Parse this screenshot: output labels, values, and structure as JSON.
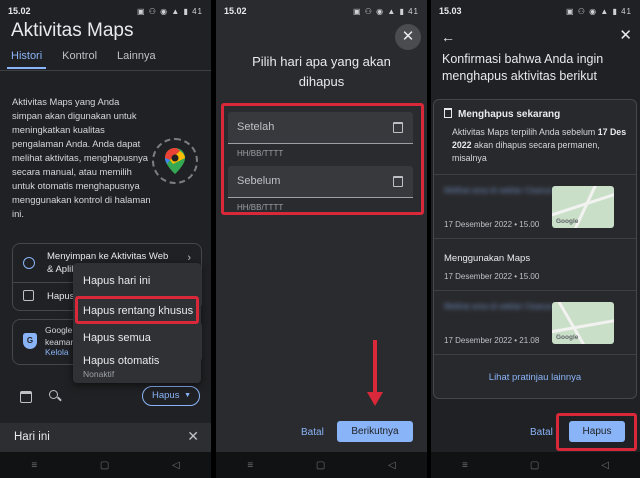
{
  "status_bars": [
    {
      "time": "15.02",
      "icons": "▣ ⚇ ◉ ▲ ▮ 41"
    },
    {
      "time": "15.02",
      "icons": "▣ ⚇ ◉ ▲ ▮ 41"
    },
    {
      "time": "15.03",
      "icons": "▣ ⚇ ◉ ▲ ▮ 41"
    }
  ],
  "panel1": {
    "title": "Aktivitas Maps",
    "tabs": [
      "Histori",
      "Kontrol",
      "Lainnya"
    ],
    "description": "Aktivitas Maps yang Anda simpan akan digunakan untuk meningkatkan kualitas pengalaman Anda. Anda dapat melihat aktivitas, menghapusnya secara manual, atau memilih untuk otomatis menghapusnya menggunakan kontrol di halaman ini.",
    "setting_card": {
      "line1": "Menyimpan ke Aktivitas Web",
      "line2": "& Aplik",
      "line3": "Hapus"
    },
    "privacy_card": {
      "line1": "Google",
      "line2": "keaman",
      "link": "Kelola"
    },
    "hapus_button": "Hapus",
    "menu": {
      "items": [
        "Hapus hari ini",
        "Hapus rentang khusus",
        "Hapus semua",
        "Hapus otomatis"
      ],
      "subtitle": "Nonaktif"
    },
    "today_label": "Hari ini"
  },
  "panel2": {
    "title": "Pilih hari apa yang akan dihapus",
    "after_label": "Setelah",
    "before_label": "Sebelum",
    "date_hint": "HH/BB/TTTT",
    "cancel": "Batal",
    "next": "Berikutnya"
  },
  "panel3": {
    "title": "Konfirmasi bahwa Anda ingin menghapus aktivitas berikut",
    "delete_now": "Menghapus sekarang",
    "body_prefix": "Aktivitas Maps terpilih Anda sebelum",
    "body_date": "17 Des 2022",
    "body_suffix": "akan dihapus secara permanen, misalnya",
    "activities": [
      {
        "blurred": "Melihat area di sekitar Cisarua",
        "date": "17 Desember 2022 • 15.00"
      },
      {
        "title": "Menggunakan Maps",
        "date": "17 Desember 2022 • 15.00"
      },
      {
        "blurred": "Melihat area di sekitar Cisarua",
        "date": "17 Desember 2022 • 21.08"
      }
    ],
    "map_brand": "Google",
    "more": "Lihat pratinjau lainnya",
    "cancel": "Batal",
    "delete": "Hapus"
  },
  "colors": {
    "accent": "#8ab4f8",
    "highlight": "#d8283a",
    "background": "#202124"
  }
}
